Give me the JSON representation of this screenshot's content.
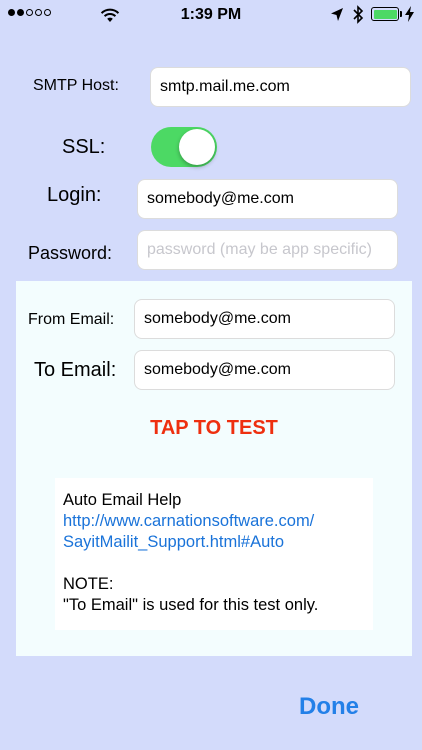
{
  "status_bar": {
    "signal_dots_filled": 2,
    "signal_dots_total": 5,
    "time": "1:39 PM",
    "icons": [
      "wifi-icon",
      "location-arrow-icon",
      "bluetooth-icon",
      "battery-icon",
      "charging-bolt-icon"
    ]
  },
  "form": {
    "smtp_host": {
      "label": "SMTP Host:",
      "value": "smtp.mail.me.com"
    },
    "ssl": {
      "label": "SSL:",
      "on": true
    },
    "login": {
      "label": "Login:",
      "value": "somebody@me.com"
    },
    "password": {
      "label": "Password:",
      "value": "",
      "placeholder": "password (may be app specific)"
    }
  },
  "test_panel": {
    "from_email": {
      "label": "From Email:",
      "value": "somebody@me.com"
    },
    "to_email": {
      "label": "To Email:",
      "value": "somebody@me.com"
    },
    "test_button": "TAP TO TEST",
    "help": {
      "title": "Auto Email Help",
      "link_line1": "http://www.carnationsoftware.com/",
      "link_line2": "SayitMailit_Support.html#Auto",
      "note_title": "NOTE:",
      "note_text": "\"To Email\" is used for this test only."
    }
  },
  "done_button": "Done",
  "colors": {
    "background": "#d3dbfb",
    "panel": "#f3fdfe",
    "toggle_on": "#4cd964",
    "test_button": "#ee2f0f",
    "link": "#1a73d9",
    "done": "#2380e8"
  }
}
